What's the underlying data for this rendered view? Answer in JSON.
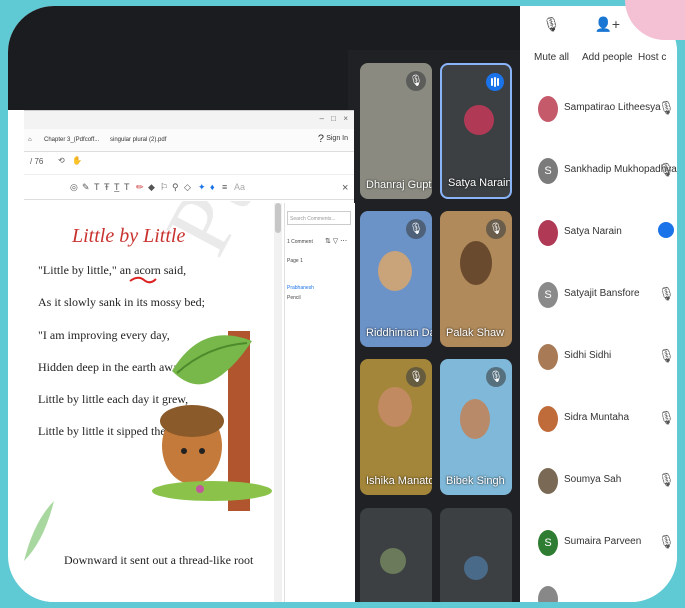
{
  "pdf": {
    "tabs": [
      "Chapter 3_(Pdfcoff...",
      "singular plural (2).pdf"
    ],
    "signin": "Sign In",
    "comment_search": "Search Comments...",
    "comment_count": "1 Comment",
    "comment_page": "Page 1",
    "comment_author": "Prabhanesh",
    "comment_text": "Pencil",
    "page": {
      "title": "Little by Little",
      "lines": [
        "\"Little by little,\" an acorn said,",
        "As it slowly sank in its mossy bed;",
        "\"I am improving every day,",
        "Hidden deep in the earth away.\"",
        "Little by little each day it grew,",
        "Little by little it sipped the dew.",
        "Downward it sent out a thread-like root"
      ]
    }
  },
  "tiles": [
    {
      "name": "Dhanraj Gupta",
      "muted": true,
      "color": "#8a8a80"
    },
    {
      "name": "Satya Narain",
      "muted": false,
      "color": "#3c4043",
      "speaking": true,
      "avatar": "#b03a56"
    },
    {
      "name": "Riddhiman Das",
      "muted": true,
      "color": "#6b93c8"
    },
    {
      "name": "Palak Shaw",
      "muted": true,
      "color": "#b08a5a"
    },
    {
      "name": "Ishika Manato",
      "muted": true,
      "color": "#a4863a"
    },
    {
      "name": "Bibek Singh",
      "muted": true,
      "color": "#7fb8d8"
    },
    {
      "name": "",
      "muted": false,
      "color": "#3c4043"
    },
    {
      "name": "",
      "muted": false,
      "color": "#3c4043"
    }
  ],
  "panel": {
    "controls": [
      "Mute all",
      "Add people",
      "Host c"
    ],
    "people": [
      {
        "name": "Sampatirao Litheesya",
        "avatar_color": "#c45a6a",
        "muted": true
      },
      {
        "name": "Sankhadip Mukhopadhyay",
        "avatar_color": "#7b7b7b",
        "initial": "S",
        "muted": true
      },
      {
        "name": "Satya Narain",
        "avatar_color": "#b03a56",
        "muted": false
      },
      {
        "name": "Satyajit Bansfore",
        "avatar_color": "#8a8a8a",
        "initial": "S",
        "muted": true
      },
      {
        "name": "Sidhi Sidhi",
        "avatar_color": "#a87a55",
        "muted": true
      },
      {
        "name": "Sidra Muntaha",
        "avatar_color": "#c06b3a",
        "muted": true
      },
      {
        "name": "Soumya Sah",
        "avatar_color": "#7a6a55",
        "muted": true
      },
      {
        "name": "Sumaira Parveen",
        "avatar_color": "#2e7d32",
        "initial": "S",
        "muted": true
      },
      {
        "name": "",
        "avatar_color": "#888888",
        "muted": false
      }
    ]
  }
}
